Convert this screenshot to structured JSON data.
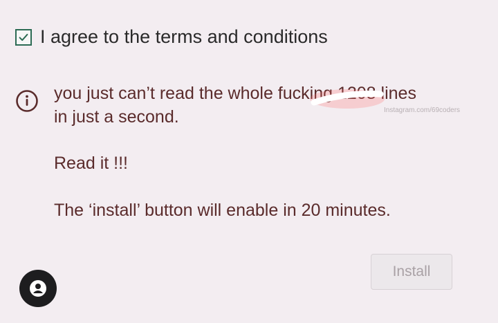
{
  "checkbox": {
    "checked": true,
    "label": "I agree to the terms and conditions"
  },
  "message": {
    "line1": "you just can’t read the whole fucking 1208 lines",
    "line2": "in just a second.",
    "line3": "Read it !!!",
    "line4": "The ‘install’ button will enable in 20 minutes."
  },
  "watermark": {
    "text": "Instagram.com/69coders"
  },
  "button": {
    "label": "Install"
  },
  "colors": {
    "background": "#f3edf1",
    "message_text": "#5a2b2b",
    "checkbox_border": "#2c6b54",
    "disabled_button_text": "#a9a1a5"
  },
  "icons": {
    "checkbox": "check-icon",
    "warning": "info-circle-icon",
    "avatar": "user-icon"
  }
}
